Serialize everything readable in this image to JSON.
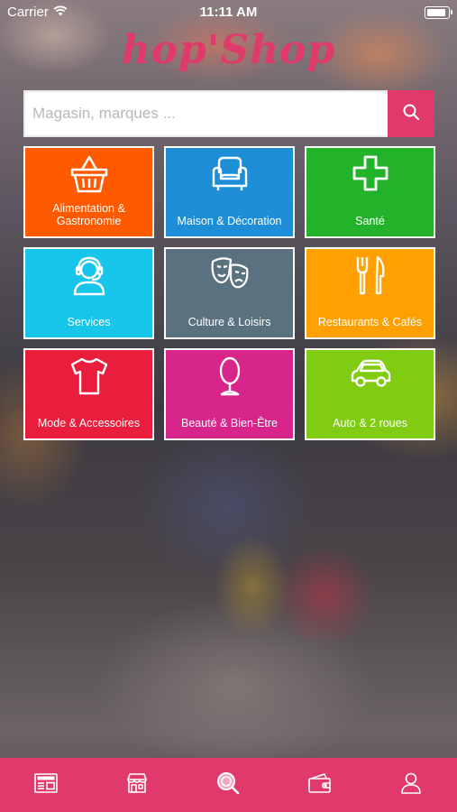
{
  "status_bar": {
    "carrier": "Carrier",
    "time": "11:11 AM",
    "battery_level": 0.9
  },
  "app": {
    "logo_text": "hop'Shop",
    "brand_color": "#e03a6a"
  },
  "search": {
    "placeholder": "Magasin, marques ...",
    "value": "",
    "icon": "search-icon"
  },
  "categories": [
    {
      "label": "Alimentation & Gastronomie",
      "icon": "basket-icon",
      "color": "#ff5a00"
    },
    {
      "label": "Maison & Décoration",
      "icon": "armchair-icon",
      "color": "#1e8fd6"
    },
    {
      "label": "Santé",
      "icon": "cross-icon",
      "color": "#22b32a"
    },
    {
      "label": "Services",
      "icon": "headset-icon",
      "color": "#18c5ea"
    },
    {
      "label": "Culture & Loisirs",
      "icon": "theater-masks-icon",
      "color": "#5a7280"
    },
    {
      "label": "Restaurants & Cafés",
      "icon": "fork-knife-icon",
      "color": "#ff9f00"
    },
    {
      "label": "Mode & Accessoires",
      "icon": "tshirt-icon",
      "color": "#e81e3c"
    },
    {
      "label": "Beauté & Bien-Être",
      "icon": "mirror-icon",
      "color": "#d8258c"
    },
    {
      "label": "Auto & 2 roues",
      "icon": "car-icon",
      "color": "#7fcc12"
    }
  ],
  "tab_bar": {
    "tabs": [
      {
        "name": "news",
        "icon": "news-icon"
      },
      {
        "name": "shops",
        "icon": "store-icon"
      },
      {
        "name": "search",
        "icon": "search-map-icon",
        "active": true
      },
      {
        "name": "wallet",
        "icon": "wallet-icon"
      },
      {
        "name": "profile",
        "icon": "user-icon"
      }
    ]
  }
}
